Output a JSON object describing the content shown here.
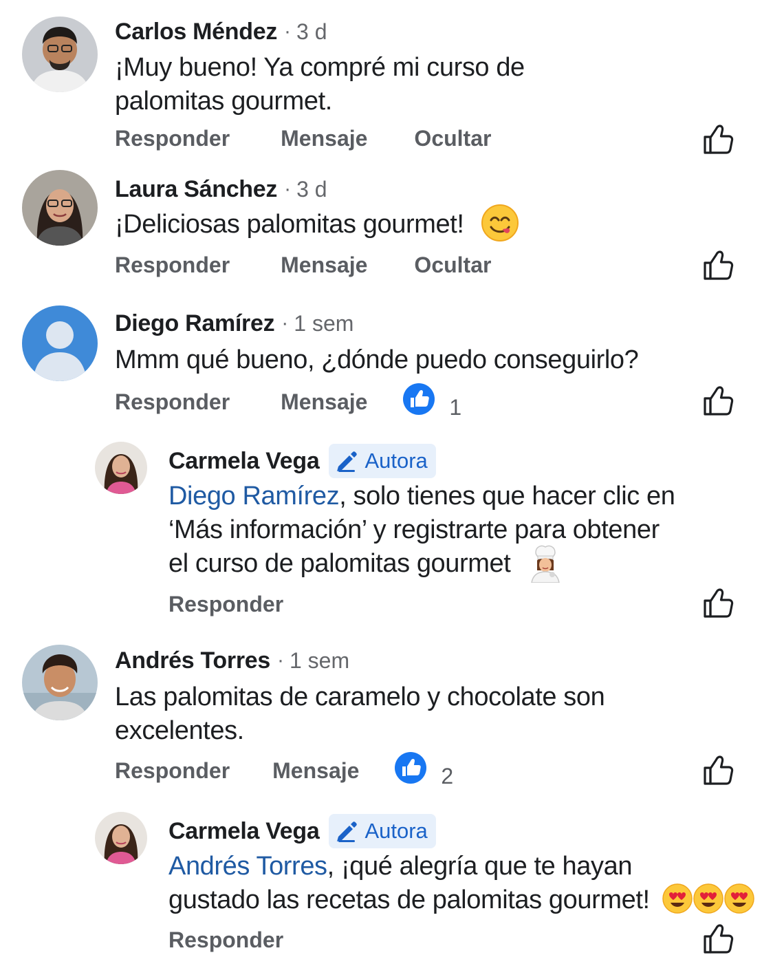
{
  "comments": [
    {
      "author": "Carlos Méndez",
      "time": "3 d",
      "text": "¡Muy bueno! Ya compré mi curso de",
      "text2": "palomitas gourmet.",
      "actions": {
        "reply": "Responder",
        "message": "Mensaje",
        "hide": "Ocultar"
      }
    },
    {
      "author": "Laura Sánchez",
      "time": "3 d",
      "text": "¡Deliciosas palomitas gourmet!",
      "emoji": "savoring-food-emoji",
      "actions": {
        "reply": "Responder",
        "message": "Mensaje",
        "hide": "Ocultar"
      }
    },
    {
      "author": "Diego Ramírez",
      "time": "1 sem",
      "text": "Mmm qué bueno, ¿dónde puedo conseguirlo?",
      "actions": {
        "reply": "Responder",
        "message": "Mensaje"
      },
      "reaction_count": "1"
    },
    {
      "author": "Carmela Vega",
      "badge": "Autora",
      "mention": "Diego Ramírez",
      "text_line1_rest": ", solo tienes que hacer clic en",
      "text_line2": "‘Más información’ y registrarte para obtener",
      "text_line3": "el curso de palomitas gourmet",
      "emoji": "woman-cook-emoji",
      "actions": {
        "reply": "Responder"
      }
    },
    {
      "author": "Andrés Torres",
      "time": "1 sem",
      "text": "Las palomitas de caramelo y chocolate son",
      "text2": "excelentes.",
      "actions": {
        "reply": "Responder",
        "message": "Mensaje"
      },
      "reaction_count": "2"
    },
    {
      "author": "Carmela Vega",
      "badge": "Autora",
      "mention": "Andrés Torres",
      "text_line1_rest": ", ¡qué alegría que te hayan",
      "text_line2": "gustado las recetas de palomitas gourmet!",
      "emoji": "heart-eyes-emoji x3",
      "actions": {
        "reply": "Responder"
      }
    }
  ],
  "colors": {
    "mention": "#1f5aa3",
    "badge_bg": "#e7f0fb",
    "badge_text": "#1a62c8",
    "reaction_blue": "#1877f2",
    "action_gray": "#5a5d62"
  }
}
